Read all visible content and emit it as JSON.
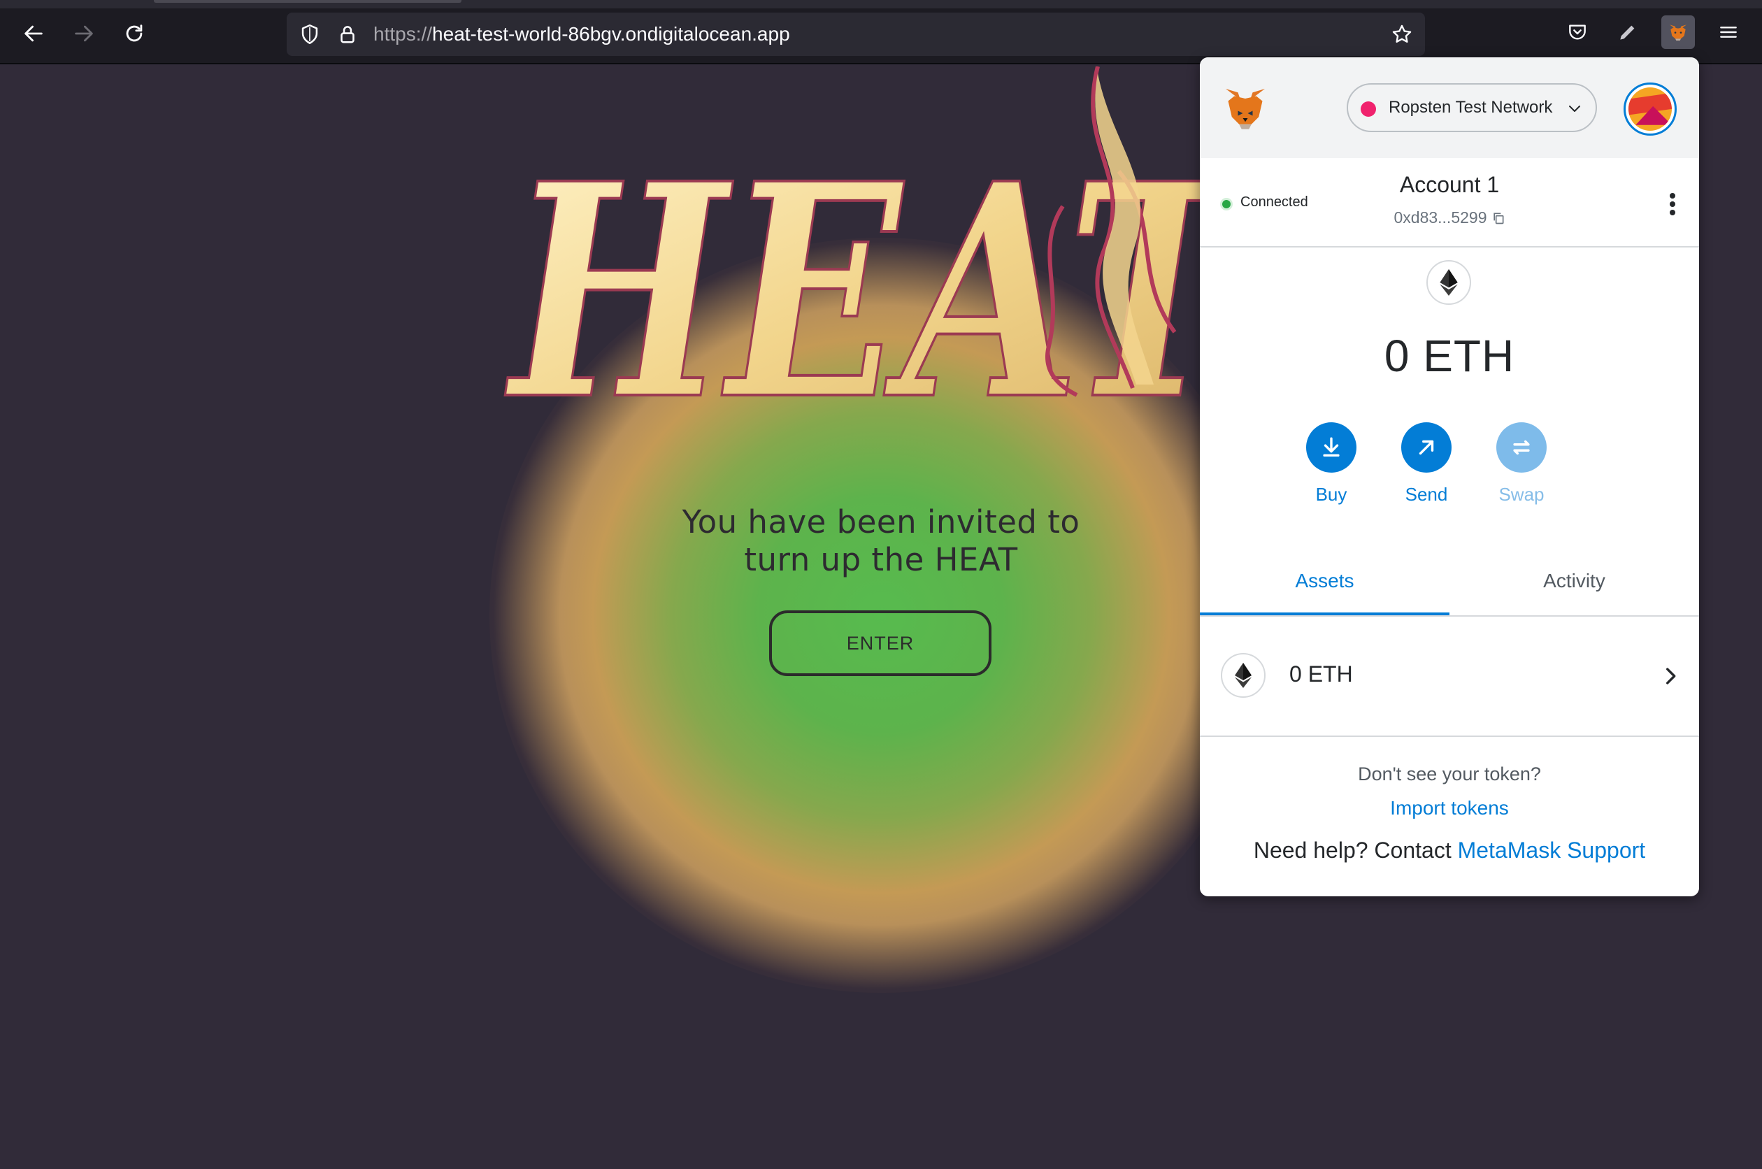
{
  "browser": {
    "url_protocol": "https://",
    "url_host": "heat-test-world-86bgv.ondigitalocean.app"
  },
  "page": {
    "logo_text": "HEAT",
    "invite_line1": "You have been invited to",
    "invite_line2": "turn up the HEAT",
    "enter_label": "ENTER"
  },
  "metamask": {
    "network_label": "Ropsten Test Network",
    "network_color": "#f0226d",
    "connection_status": "Connected",
    "account_name": "Account 1",
    "account_address": "0xd83...5299",
    "balance": "0 ETH",
    "actions": [
      {
        "label": "Buy",
        "icon": "download-icon"
      },
      {
        "label": "Send",
        "icon": "arrow-up-right-icon"
      },
      {
        "label": "Swap",
        "icon": "swap-icon"
      }
    ],
    "tabs": [
      "Assets",
      "Activity"
    ],
    "assets": [
      {
        "label": "0 ETH",
        "icon": "eth-icon"
      }
    ],
    "dont_see_text": "Don't see your token?",
    "import_link": "Import tokens",
    "help_prefix": "Need help? Contact",
    "help_link": "MetaMask Support",
    "accent_color": "#037dd6"
  }
}
